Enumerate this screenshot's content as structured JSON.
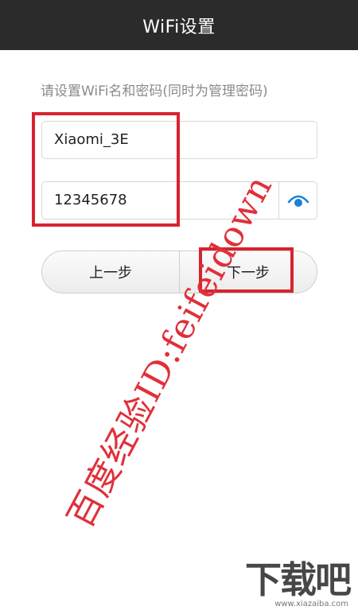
{
  "header": {
    "title": "WiFi设置"
  },
  "form": {
    "hint": "请设置WiFi名和密码(同时为管理密码)",
    "ssid_value": "Xiaomi_3E",
    "password_value": "12345678",
    "show_password_icon": "eye-icon"
  },
  "buttons": {
    "prev_label": "上一步",
    "next_label": "下一步"
  },
  "watermark": {
    "text": "百度经验ID:feifeidown"
  },
  "site_logo": {
    "text": "下载吧",
    "url_text": "www.xiazaiba.com"
  },
  "colors": {
    "titlebar": "#2b2b2b",
    "accent_eye": "#1e7fd8",
    "annotation_red": "#d8232f"
  }
}
